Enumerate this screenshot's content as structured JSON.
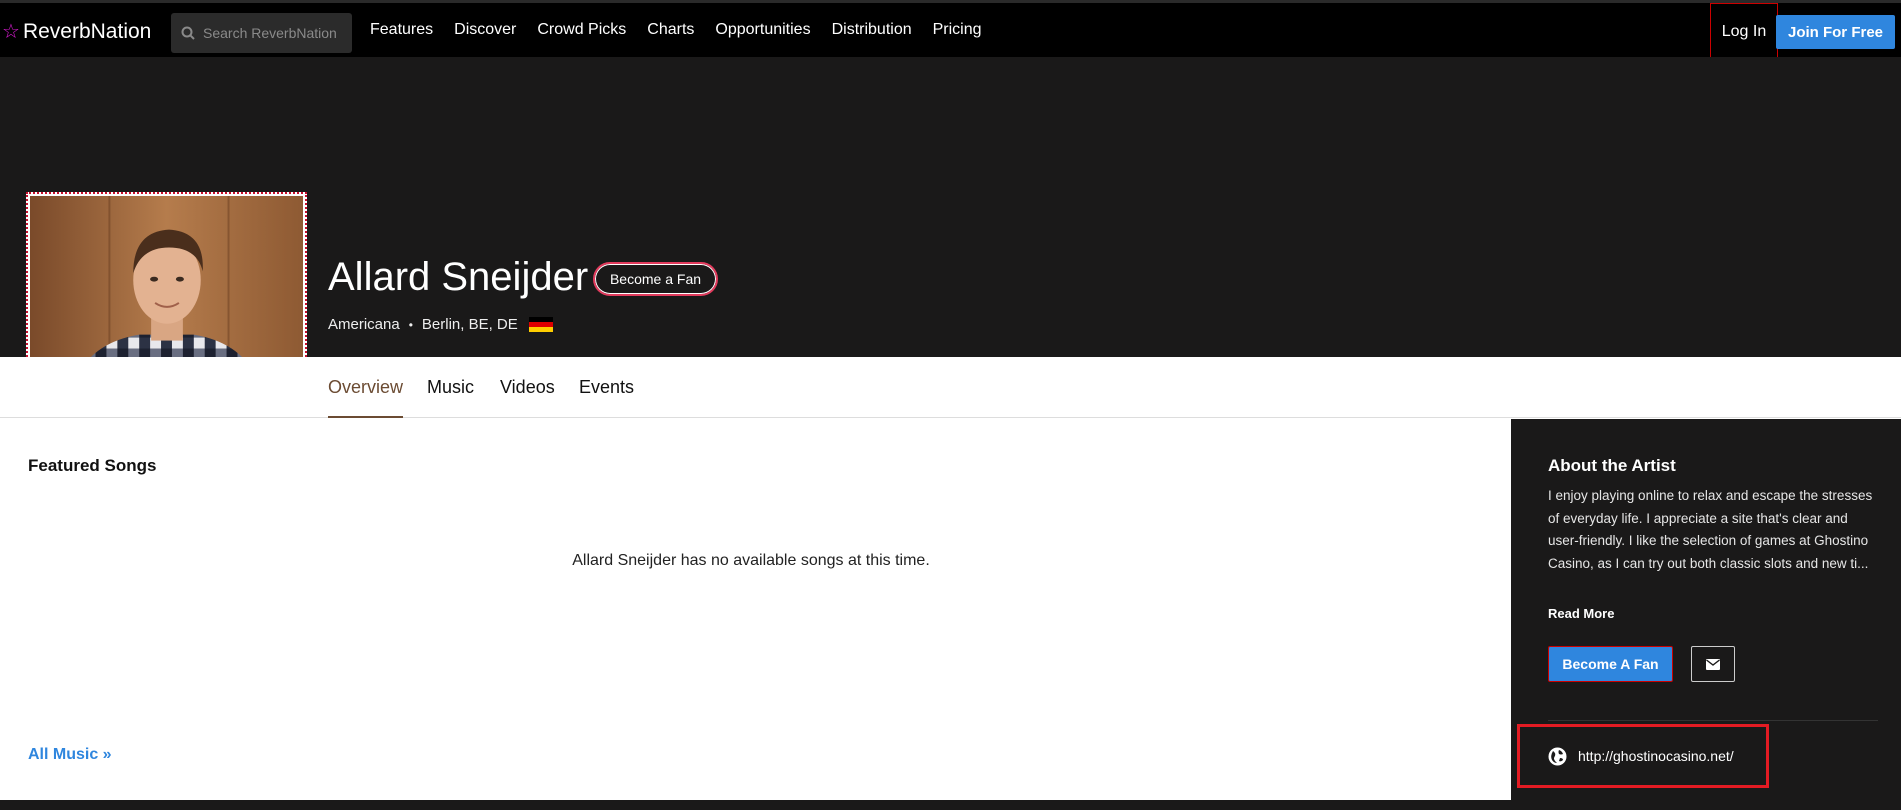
{
  "nav": {
    "logo_text": "ReverbNation",
    "search_placeholder": "Search ReverbNation",
    "links": [
      "Features",
      "Discover",
      "Crowd Picks",
      "Charts",
      "Opportunities",
      "Distribution",
      "Pricing"
    ],
    "login": "Log In",
    "join": "Join For Free"
  },
  "artist": {
    "name": "Allard Sneijder",
    "become_fan": "Become a Fan",
    "genre": "Americana",
    "location": "Berlin, BE, DE",
    "flag_icon": "germany-flag-icon"
  },
  "tabs": [
    "Overview",
    "Music",
    "Videos",
    "Events"
  ],
  "main": {
    "featured_title": "Featured Songs",
    "empty_message": "Allard Sneijder has no available songs at this time.",
    "all_music": "All Music »"
  },
  "sidebar": {
    "about_title": "About the Artist",
    "about_text": "I enjoy playing online to relax and escape the stresses of everyday life. I appreciate a site that's clear and user-friendly. I like the selection of games at Ghostino Casino, as I can try out both classic slots and new ti...",
    "read_more": "Read More",
    "become_fan": "Become A Fan",
    "website": "http://ghostinocasino.net/"
  },
  "colors": {
    "accent_blue": "#2f86de",
    "brand_star": "#d81bd1",
    "active_tab": "#6b4b32",
    "dark_bg": "#1a1919",
    "highlight_red": "#e31b23"
  }
}
